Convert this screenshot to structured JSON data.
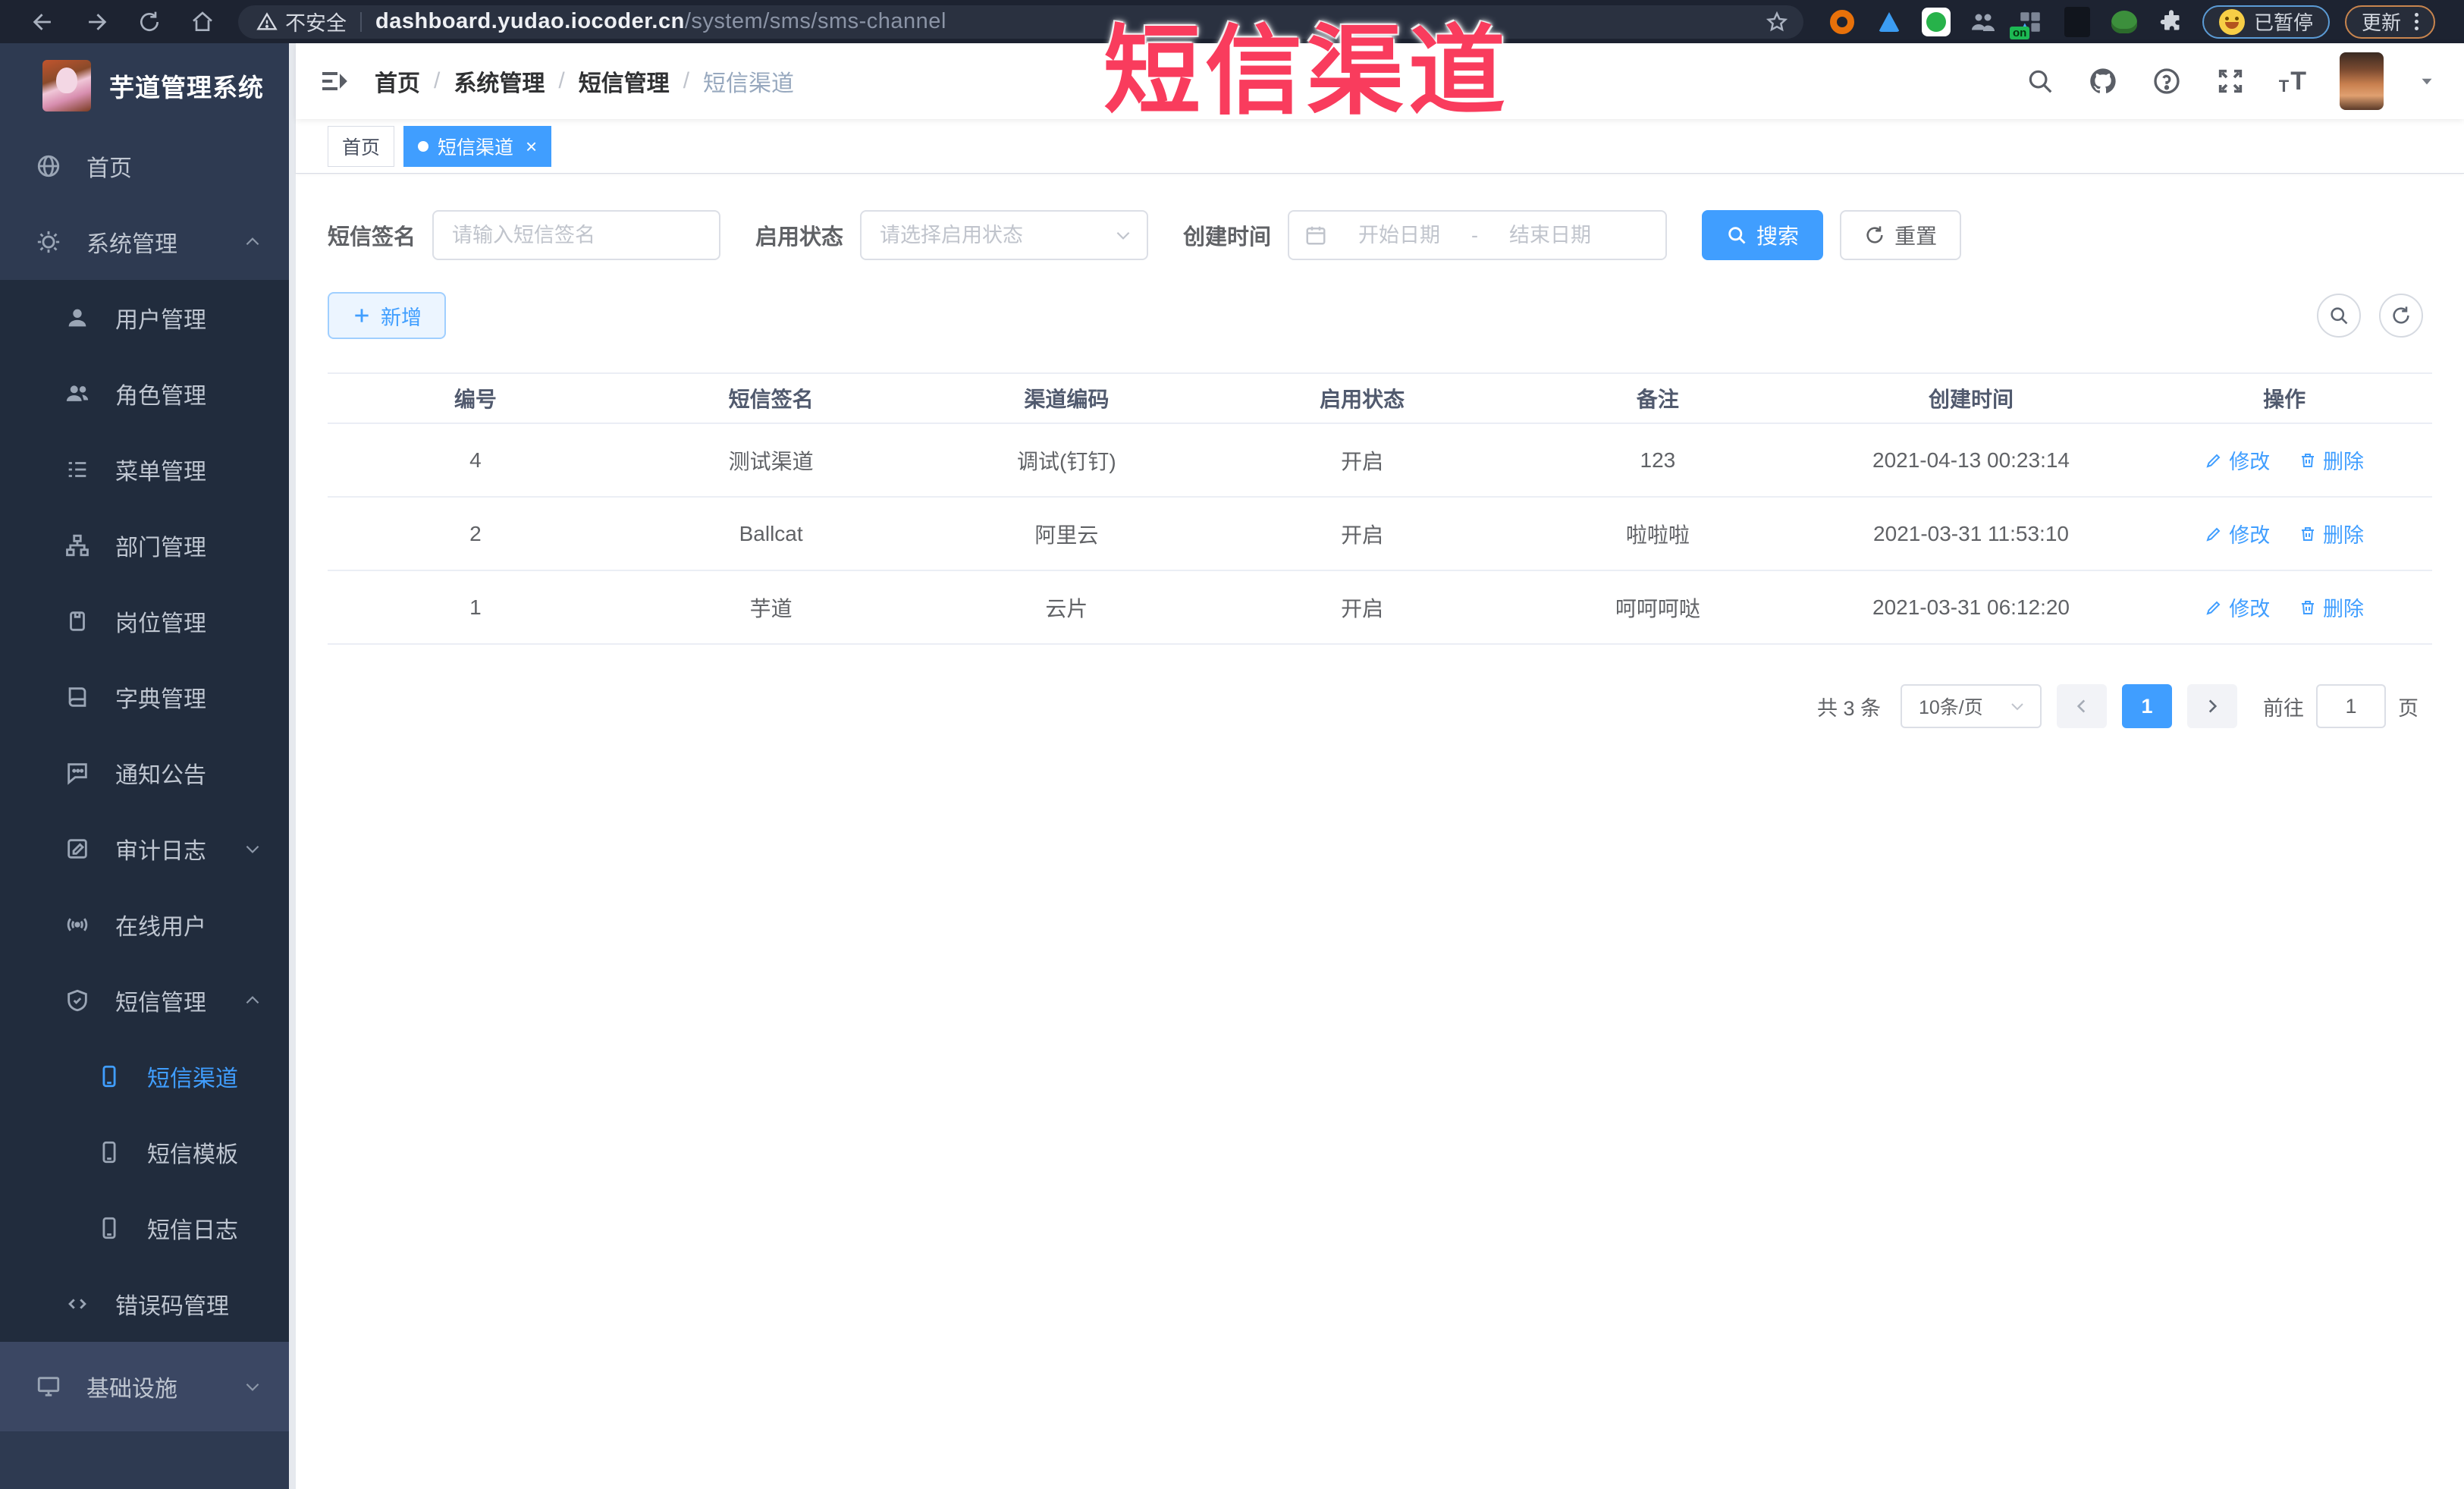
{
  "watermark": "短信渠道",
  "browser": {
    "security_label": "不安全",
    "url_host": "dashboard.yudao.iocoder.cn",
    "url_path": "/system/sms/sms-channel",
    "paused_badge": "已暂停",
    "update_badge": "更新"
  },
  "sidebar": {
    "app_title": "芋道管理系统",
    "items": [
      {
        "label": "首页"
      },
      {
        "label": "系统管理"
      },
      {
        "label": "用户管理"
      },
      {
        "label": "角色管理"
      },
      {
        "label": "菜单管理"
      },
      {
        "label": "部门管理"
      },
      {
        "label": "岗位管理"
      },
      {
        "label": "字典管理"
      },
      {
        "label": "通知公告"
      },
      {
        "label": "审计日志"
      },
      {
        "label": "在线用户"
      },
      {
        "label": "短信管理"
      },
      {
        "label": "短信渠道"
      },
      {
        "label": "短信模板"
      },
      {
        "label": "短信日志"
      },
      {
        "label": "错误码管理"
      },
      {
        "label": "基础设施"
      }
    ]
  },
  "breadcrumb": [
    "首页",
    "系统管理",
    "短信管理",
    "短信渠道"
  ],
  "tabs": [
    {
      "label": "首页"
    },
    {
      "label": "短信渠道",
      "close": "×"
    }
  ],
  "filters": {
    "sign_label": "短信签名",
    "sign_placeholder": "请输入短信签名",
    "status_label": "启用状态",
    "status_placeholder": "请选择启用状态",
    "time_label": "创建时间",
    "start_placeholder": "开始日期",
    "range_separator": "-",
    "end_placeholder": "结束日期",
    "search": "搜索",
    "reset": "重置"
  },
  "toolbar": {
    "add": "新增"
  },
  "table": {
    "headers": [
      "编号",
      "短信签名",
      "渠道编码",
      "启用状态",
      "备注",
      "创建时间",
      "操作"
    ],
    "rows": [
      {
        "id": "4",
        "sign": "测试渠道",
        "code": "调试(钉钉)",
        "status": "开启",
        "remark": "123",
        "time": "2021-04-13 00:23:14"
      },
      {
        "id": "2",
        "sign": "Ballcat",
        "code": "阿里云",
        "status": "开启",
        "remark": "啦啦啦",
        "time": "2021-03-31 11:53:10"
      },
      {
        "id": "1",
        "sign": "芋道",
        "code": "云片",
        "status": "开启",
        "remark": "呵呵呵哒",
        "time": "2021-03-31 06:12:20"
      }
    ],
    "edit": "修改",
    "delete": "删除"
  },
  "pagination": {
    "total": "共 3 条",
    "page_size": "10条/页",
    "current": "1",
    "goto_label": "前往",
    "goto_value": "1",
    "page_unit": "页"
  },
  "colors": {
    "primary": "#409eff",
    "watermark_red": "#f93c5d",
    "sidebar_bg": "#2e3a51",
    "submenu_bg": "#212c3d"
  }
}
